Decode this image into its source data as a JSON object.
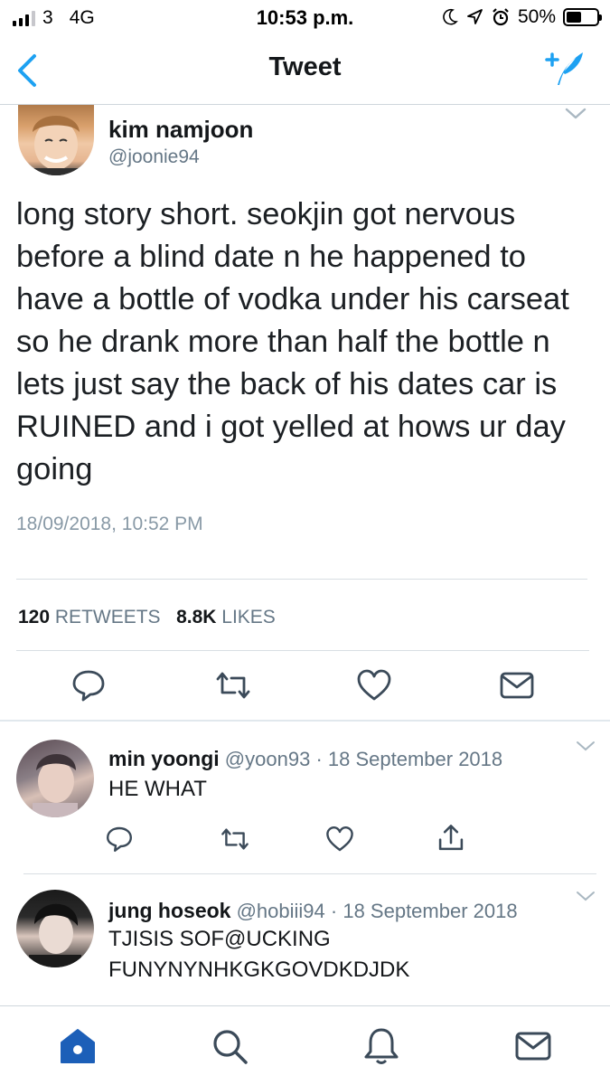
{
  "status_bar": {
    "carrier": "3",
    "network": "4G",
    "time": "10:53 p.m.",
    "battery": "50%"
  },
  "nav": {
    "title": "Tweet",
    "back_icon": "chevron-left-icon",
    "compose_icon": "compose-tweet-icon"
  },
  "tweet": {
    "author_name": "kim namjoon",
    "author_handle": "@joonie94",
    "text": "long story short. seokjin got nervous before a blind date n he happened to have a bottle of vodka under his carseat so he drank more than half the bottle n lets just say the back of his dates car is RUINED and i got yelled at hows ur day going",
    "timestamp": "18/09/2018, 10:52 PM",
    "retweets_count": "120",
    "retweets_label": "RETWEETS",
    "likes_count": "8.8K",
    "likes_label": "LIKES"
  },
  "replies": [
    {
      "name": "min yoongi",
      "handle": "@yoon93",
      "separator": "·",
      "date": "18 September 2018",
      "text": "HE WHAT"
    },
    {
      "name": "jung hoseok",
      "handle": "@hobiii94",
      "separator": "·",
      "date": "18 September 2018",
      "text_line1": "TJISIS SOF@UCKING",
      "text_line2": "FUNYNYNHKGKGOVDKDJDK"
    }
  ],
  "tab_bar": {
    "items": [
      "home-icon",
      "search-icon",
      "notifications-icon",
      "messages-icon"
    ],
    "active": "home-icon"
  },
  "colors": {
    "accent": "#1da1f2",
    "active_tab": "#1c5fb8",
    "text": "#14171a",
    "muted": "#657786"
  }
}
